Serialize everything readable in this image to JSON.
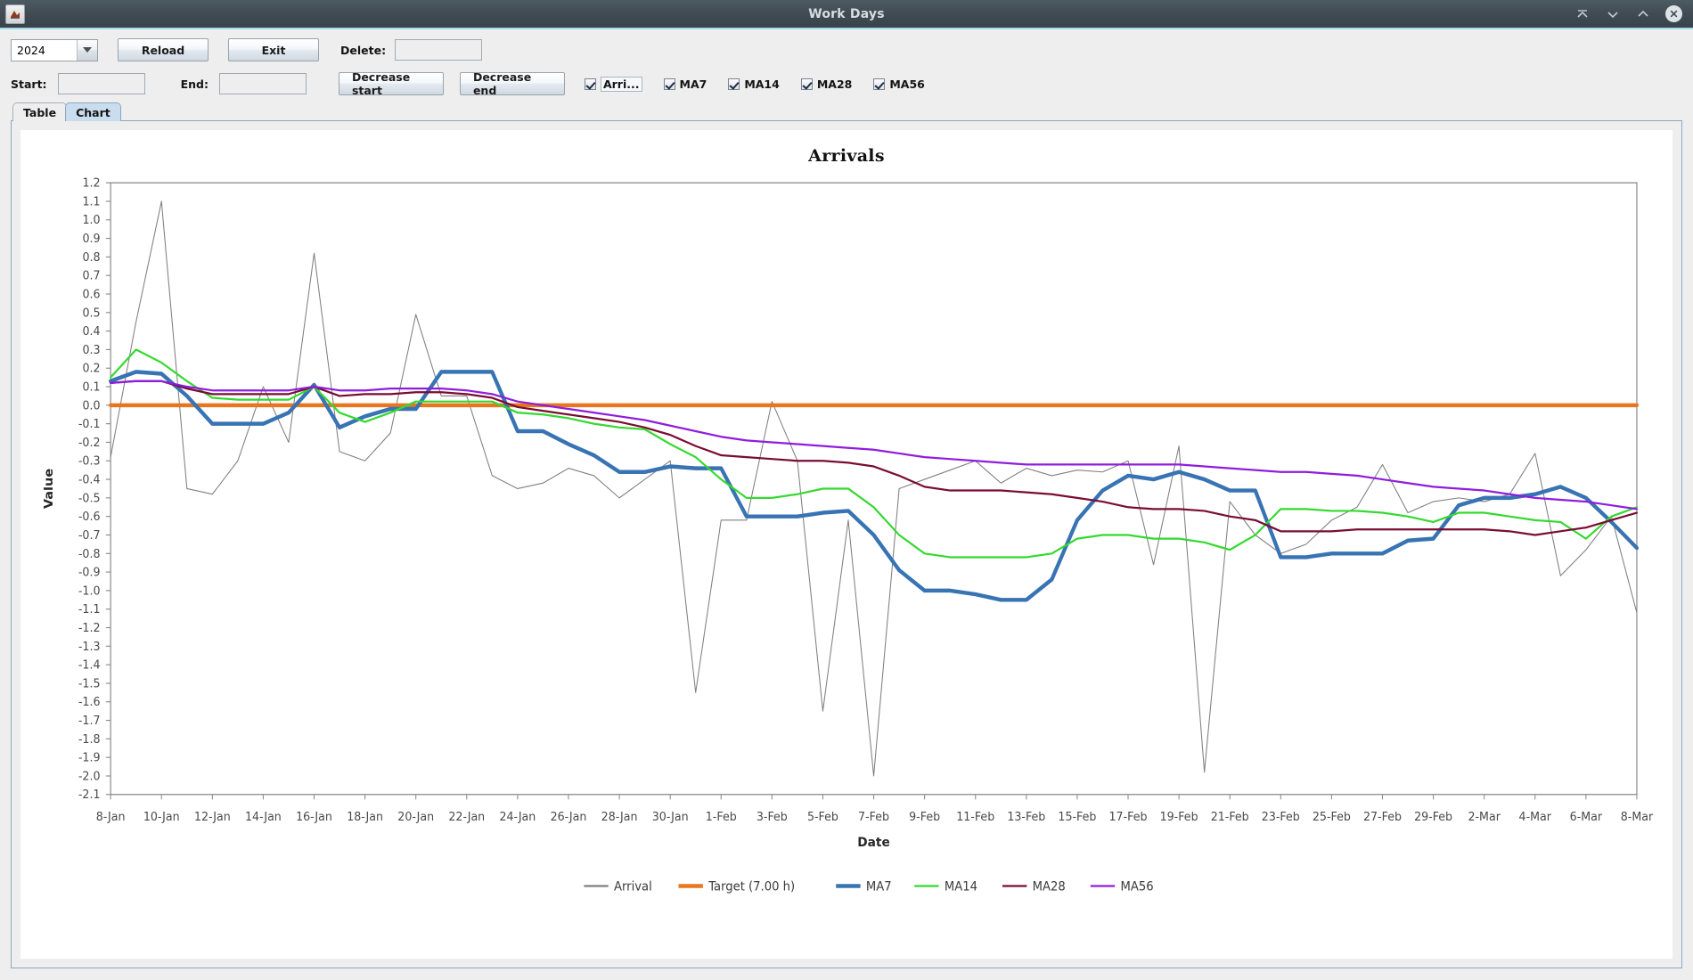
{
  "window": {
    "title": "Work Days",
    "icon": "app-icon",
    "controls": [
      {
        "name": "shade-button",
        "glyph": "⌃"
      },
      {
        "name": "minimize-button",
        "glyph": "∨"
      },
      {
        "name": "maximize-button",
        "glyph": "∧"
      },
      {
        "name": "close-button",
        "glyph": "✕"
      }
    ]
  },
  "toolbar": {
    "year_selected": "2024",
    "year_options": [
      "2024"
    ],
    "reload_label": "Reload",
    "exit_label": "Exit",
    "delete_label": "Delete:",
    "delete_value": "",
    "delete_placeholder": "",
    "start_label": "Start:",
    "start_value": "",
    "end_label": "End:",
    "end_value": "",
    "decrease_start_label": "Decrease start",
    "decrease_end_label": "Decrease end",
    "checkboxes": [
      {
        "label": "Arri...",
        "checked": true,
        "focused": true
      },
      {
        "label": "MA7",
        "checked": true,
        "focused": false
      },
      {
        "label": "MA14",
        "checked": true,
        "focused": false
      },
      {
        "label": "MA28",
        "checked": true,
        "focused": false
      },
      {
        "label": "MA56",
        "checked": true,
        "focused": false
      }
    ]
  },
  "tabs": [
    {
      "label": "Table",
      "active": false
    },
    {
      "label": "Chart",
      "active": true
    }
  ],
  "chart_data": {
    "type": "line",
    "title": "Arrivals",
    "xlabel": "Date",
    "ylabel": "Value",
    "ylim": [
      -2.1,
      1.2
    ],
    "ytick_step": 0.1,
    "yticks": [
      1.2,
      1.1,
      1.0,
      0.9,
      0.8,
      0.7,
      0.6,
      0.5,
      0.4,
      0.3,
      0.2,
      0.1,
      0.0,
      -0.1,
      -0.2,
      -0.3,
      -0.4,
      -0.5,
      -0.6,
      -0.7,
      -0.8,
      -0.9,
      -1.0,
      -1.1,
      -1.2,
      -1.3,
      -1.4,
      -1.5,
      -1.6,
      -1.7,
      -1.8,
      -1.9,
      -2.0,
      -2.1
    ],
    "grid": false,
    "legend_position": "bottom",
    "x_start_label": "8-Jan",
    "x_end_label": "8-Mar",
    "x_tick_every": 2,
    "x": [
      "8-Jan",
      "9-Jan",
      "10-Jan",
      "11-Jan",
      "12-Jan",
      "13-Jan",
      "14-Jan",
      "15-Jan",
      "16-Jan",
      "17-Jan",
      "18-Jan",
      "19-Jan",
      "20-Jan",
      "21-Jan",
      "22-Jan",
      "23-Jan",
      "24-Jan",
      "25-Jan",
      "26-Jan",
      "27-Jan",
      "28-Jan",
      "29-Jan",
      "30-Jan",
      "31-Jan",
      "1-Feb",
      "2-Feb",
      "3-Feb",
      "4-Feb",
      "5-Feb",
      "6-Feb",
      "7-Feb",
      "8-Feb",
      "9-Feb",
      "10-Feb",
      "11-Feb",
      "12-Feb",
      "13-Feb",
      "14-Feb",
      "15-Feb",
      "16-Feb",
      "17-Feb",
      "18-Feb",
      "19-Feb",
      "20-Feb",
      "21-Feb",
      "22-Feb",
      "23-Feb",
      "24-Feb",
      "25-Feb",
      "26-Feb",
      "27-Feb",
      "28-Feb",
      "29-Feb",
      "1-Mar",
      "2-Mar",
      "3-Mar",
      "4-Mar",
      "5-Mar",
      "6-Mar",
      "7-Mar",
      "8-Mar"
    ],
    "xticks": [
      "8-Jan",
      "10-Jan",
      "12-Jan",
      "14-Jan",
      "16-Jan",
      "18-Jan",
      "20-Jan",
      "22-Jan",
      "24-Jan",
      "26-Jan",
      "28-Jan",
      "30-Jan",
      "1-Feb",
      "3-Feb",
      "5-Feb",
      "7-Feb",
      "9-Feb",
      "11-Feb",
      "13-Feb",
      "15-Feb",
      "17-Feb",
      "19-Feb",
      "21-Feb",
      "23-Feb",
      "25-Feb",
      "27-Feb",
      "29-Feb",
      "2-Mar",
      "4-Mar",
      "6-Mar",
      "8-Mar"
    ],
    "series": [
      {
        "name": "Arrival",
        "color": "#808080",
        "width": 1,
        "values": [
          -0.28,
          0.45,
          1.1,
          -0.45,
          -0.48,
          -0.3,
          0.1,
          -0.2,
          0.82,
          -0.25,
          -0.3,
          -0.15,
          0.49,
          0.05,
          0.05,
          -0.38,
          -0.45,
          -0.42,
          -0.34,
          -0.38,
          -0.5,
          -0.4,
          -0.3,
          -1.55,
          -0.62,
          -0.62,
          0.02,
          -0.3,
          -1.65,
          -0.62,
          -2.0,
          -0.45,
          -0.4,
          -0.35,
          -0.3,
          -0.42,
          -0.34,
          -0.38,
          -0.35,
          -0.36,
          -0.3,
          -0.86,
          -0.22,
          -1.98,
          -0.52,
          -0.7,
          -0.8,
          -0.75,
          -0.62,
          -0.55,
          -0.32,
          -0.58,
          -0.52,
          -0.5,
          -0.52,
          -0.48,
          -0.26,
          -0.92,
          -0.78,
          -0.6,
          -1.12
        ]
      },
      {
        "name": "Target (7.00 h)",
        "color": "#e8761e",
        "width": 4,
        "values": [
          0,
          0,
          0,
          0,
          0,
          0,
          0,
          0,
          0,
          0,
          0,
          0,
          0,
          0,
          0,
          0,
          0,
          0,
          0,
          0,
          0,
          0,
          0,
          0,
          0,
          0,
          0,
          0,
          0,
          0,
          0,
          0,
          0,
          0,
          0,
          0,
          0,
          0,
          0,
          0,
          0,
          0,
          0,
          0,
          0,
          0,
          0,
          0,
          0,
          0,
          0,
          0,
          0,
          0,
          0,
          0,
          0,
          0,
          0,
          0,
          0
        ]
      },
      {
        "name": "MA7",
        "color": "#3873b3",
        "width": 4,
        "values": [
          0.13,
          0.18,
          0.17,
          0.05,
          -0.1,
          -0.1,
          -0.1,
          -0.04,
          0.11,
          -0.12,
          -0.06,
          -0.02,
          -0.02,
          0.18,
          0.18,
          0.18,
          -0.14,
          -0.14,
          -0.21,
          -0.27,
          -0.36,
          -0.36,
          -0.33,
          -0.34,
          -0.34,
          -0.6,
          -0.6,
          -0.6,
          -0.58,
          -0.57,
          -0.7,
          -0.89,
          -1.0,
          -1.0,
          -1.02,
          -1.05,
          -1.05,
          -0.94,
          -0.62,
          -0.46,
          -0.38,
          -0.4,
          -0.36,
          -0.4,
          -0.46,
          -0.46,
          -0.82,
          -0.82,
          -0.8,
          -0.8,
          -0.8,
          -0.73,
          -0.72,
          -0.54,
          -0.5,
          -0.5,
          -0.48,
          -0.44,
          -0.5,
          -0.63,
          -0.77
        ]
      },
      {
        "name": "MA14",
        "color": "#34d92f",
        "width": 2,
        "values": [
          0.15,
          0.3,
          0.23,
          0.13,
          0.04,
          0.03,
          0.03,
          0.03,
          0.1,
          -0.04,
          -0.09,
          -0.04,
          0.02,
          0.02,
          0.02,
          0.02,
          -0.04,
          -0.05,
          -0.07,
          -0.1,
          -0.12,
          -0.13,
          -0.21,
          -0.28,
          -0.4,
          -0.5,
          -0.5,
          -0.48,
          -0.45,
          -0.45,
          -0.55,
          -0.7,
          -0.8,
          -0.82,
          -0.82,
          -0.82,
          -0.82,
          -0.8,
          -0.72,
          -0.7,
          -0.7,
          -0.72,
          -0.72,
          -0.74,
          -0.78,
          -0.7,
          -0.56,
          -0.56,
          -0.57,
          -0.57,
          -0.58,
          -0.6,
          -0.63,
          -0.58,
          -0.58,
          -0.6,
          -0.62,
          -0.63,
          -0.72,
          -0.6,
          -0.55
        ]
      },
      {
        "name": "MA28",
        "color": "#7a0c33",
        "width": 2,
        "values": [
          0.12,
          0.13,
          0.13,
          0.09,
          0.06,
          0.06,
          0.06,
          0.06,
          0.1,
          0.05,
          0.06,
          0.06,
          0.07,
          0.07,
          0.06,
          0.04,
          -0.01,
          -0.03,
          -0.05,
          -0.07,
          -0.09,
          -0.12,
          -0.16,
          -0.22,
          -0.27,
          -0.28,
          -0.29,
          -0.3,
          -0.3,
          -0.31,
          -0.33,
          -0.38,
          -0.44,
          -0.46,
          -0.46,
          -0.46,
          -0.47,
          -0.48,
          -0.5,
          -0.52,
          -0.55,
          -0.56,
          -0.56,
          -0.57,
          -0.6,
          -0.62,
          -0.68,
          -0.68,
          -0.68,
          -0.67,
          -0.67,
          -0.67,
          -0.67,
          -0.67,
          -0.67,
          -0.68,
          -0.7,
          -0.68,
          -0.66,
          -0.62,
          -0.58
        ]
      },
      {
        "name": "MA56",
        "color": "#8f1ddd",
        "width": 2,
        "values": [
          0.12,
          0.13,
          0.13,
          0.1,
          0.08,
          0.08,
          0.08,
          0.08,
          0.1,
          0.08,
          0.08,
          0.09,
          0.09,
          0.09,
          0.08,
          0.06,
          0.02,
          0.0,
          -0.02,
          -0.04,
          -0.06,
          -0.08,
          -0.11,
          -0.14,
          -0.17,
          -0.19,
          -0.2,
          -0.21,
          -0.22,
          -0.23,
          -0.24,
          -0.26,
          -0.28,
          -0.29,
          -0.3,
          -0.31,
          -0.32,
          -0.32,
          -0.32,
          -0.32,
          -0.32,
          -0.32,
          -0.32,
          -0.33,
          -0.34,
          -0.35,
          -0.36,
          -0.36,
          -0.37,
          -0.38,
          -0.4,
          -0.42,
          -0.44,
          -0.45,
          -0.46,
          -0.48,
          -0.5,
          -0.51,
          -0.52,
          -0.54,
          -0.56
        ]
      }
    ]
  }
}
